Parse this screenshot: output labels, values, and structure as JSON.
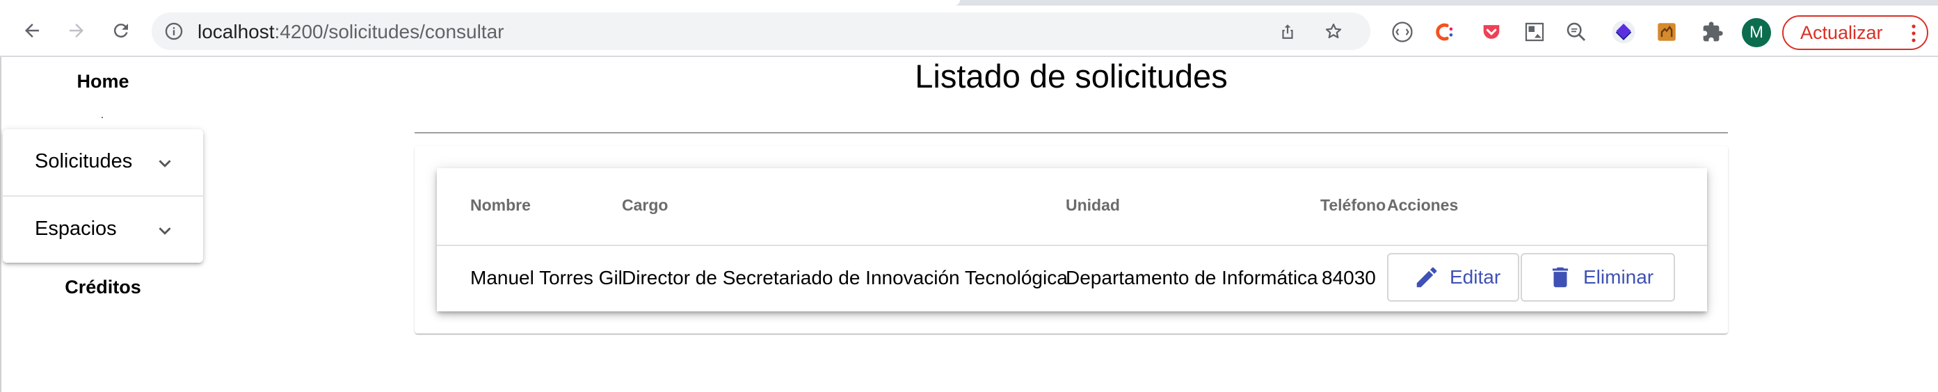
{
  "browser": {
    "url_host": "localhost",
    "url_rest": ":4200/solicitudes/consultar",
    "profile_initial": "M",
    "update_label": "Actualizar"
  },
  "sidenav": {
    "home": "Home",
    "panels": [
      {
        "label": "Solicitudes"
      },
      {
        "label": "Espacios"
      }
    ],
    "creditos": "Créditos"
  },
  "page": {
    "title": "Listado de solicitudes"
  },
  "table": {
    "headers": [
      "Nombre",
      "Cargo",
      "Unidad",
      "Teléfono",
      "Acciones"
    ],
    "rows": [
      {
        "nombre": "Manuel Torres Gil",
        "cargo": "Director de Secretariado de Innovación Tecnológica",
        "unidad": "Departamento de Informática",
        "telefono": "84030"
      }
    ],
    "edit_label": "Editar",
    "delete_label": "Eliminar"
  },
  "colors": {
    "primary": "#3f51b5",
    "update_red": "#d93025",
    "avatar_green": "#0b6d4e"
  },
  "icons": [
    "back-arrow-icon",
    "forward-arrow-icon",
    "reload-icon",
    "info-icon",
    "share-icon",
    "star-icon",
    "pencil-icon",
    "trash-icon",
    "chevron-down-icon",
    "puzzle-icon",
    "more-vert-icon"
  ]
}
